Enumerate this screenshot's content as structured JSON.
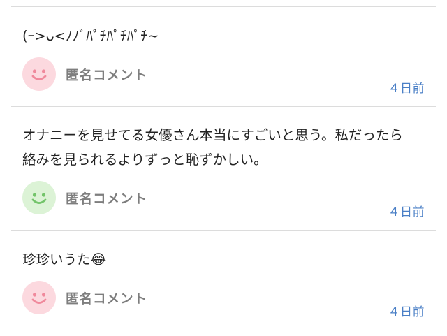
{
  "colors": {
    "divider": "#dcdcdc",
    "author_text": "#7e7e7e",
    "timestamp_text": "#4a7fc6",
    "avatar_pink_bg": "#fcd9df",
    "avatar_pink_face": "#f0899c",
    "avatar_green_bg": "#dcf3d6",
    "avatar_green_face": "#73c46a"
  },
  "comments": [
    {
      "text": "(ｰ>ᴗ<ﾉﾉﾞﾊﾟﾁﾊﾟﾁﾊﾟﾁ~",
      "author": "匿名コメント",
      "time": "４日前",
      "avatar_icon": "smiley-face-icon",
      "avatar_color": "pink"
    },
    {
      "text": "オナニーを見せてる女優さん本当にすごいと思う。私だったら絡みを見られるよりずっと恥ずかしい。",
      "author": "匿名コメント",
      "time": "４日前",
      "avatar_icon": "smiley-face-icon",
      "avatar_color": "green"
    },
    {
      "text": "珍珍いうた😂",
      "author": "匿名コメント",
      "time": "４日前",
      "avatar_icon": "smiley-face-icon",
      "avatar_color": "pink"
    }
  ]
}
